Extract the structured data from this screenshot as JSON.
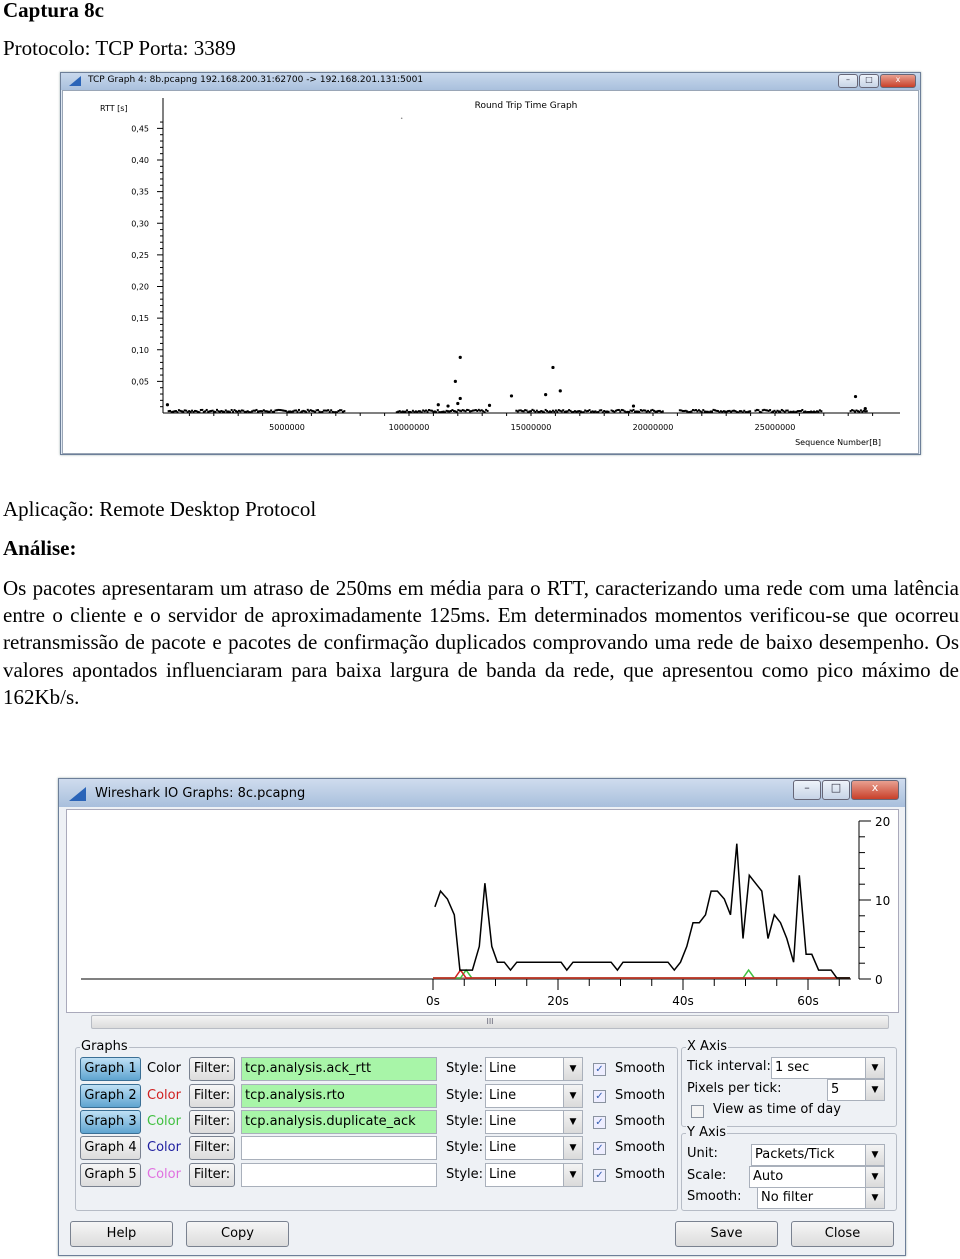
{
  "doc": {
    "heading": "Captura 8c",
    "protocol_line": "Protocolo: TCP  Porta: 3389",
    "application_line": "Aplicação: Remote Desktop Protocol",
    "analysis_label": "Análise:",
    "analysis_text": "Os pacotes apresentaram um atraso de 250ms em média para o RTT, caracterizando uma rede com uma latência entre o cliente e o servidor de aproximadamente 125ms. Em determinados momentos verificou-se que ocorreu retransmissão de pacote e pacotes de confirmação duplicados comprovando uma rede de baixo desempenho. Os valores apontados influenciaram para baixa largura de banda da rede, que apresentou como pico máximo de 162Kb/s."
  },
  "rtt_window": {
    "title": "TCP Graph 4: 8b.pcapng 192.168.200.31:62700 -> 192.168.201.131:5001",
    "controls": {
      "minimize": "–",
      "maximize": "□",
      "close": "x"
    }
  },
  "io_window": {
    "title": "Wireshark IO Graphs: 8c.pcapng",
    "controls": {
      "minimize": "–",
      "maximize": "□",
      "close": "x"
    },
    "graphs_legend": "Graphs",
    "color_label": "Color",
    "filter_label": "Filter:",
    "style_label": "Style:",
    "smooth_label": "Smooth",
    "graphs": [
      {
        "name": "Graph 1",
        "color": "#000000",
        "filter": "tcp.analysis.ack_rtt",
        "style": "Line",
        "smooth": true,
        "active": true
      },
      {
        "name": "Graph 2",
        "color": "#d02020",
        "filter": "tcp.analysis.rto",
        "style": "Line",
        "smooth": true,
        "active": true
      },
      {
        "name": "Graph 3",
        "color": "#40c040",
        "filter": "tcp.analysis.duplicate_ack",
        "style": "Line",
        "smooth": true,
        "active": true
      },
      {
        "name": "Graph 4",
        "color": "#2020a0",
        "filter": "",
        "style": "Line",
        "smooth": true,
        "active": false
      },
      {
        "name": "Graph 5",
        "color": "#e070e0",
        "filter": "",
        "style": "Line",
        "smooth": true,
        "active": false
      }
    ],
    "x_axis": {
      "legend": "X Axis",
      "tick_interval_label": "Tick interval:",
      "tick_interval": "1 sec",
      "pixels_per_tick_label": "Pixels per tick:",
      "pixels_per_tick": "5",
      "time_of_day_label": "View as time of day",
      "time_of_day": false
    },
    "y_axis": {
      "legend": "Y Axis",
      "unit_label": "Unit:",
      "unit": "Packets/Tick",
      "scale_label": "Scale:",
      "scale": "Auto",
      "smooth_label": "Smooth:",
      "smooth": "No filter"
    },
    "buttons": {
      "help": "Help",
      "copy": "Copy",
      "save": "Save",
      "close": "Close"
    },
    "scrollbar_grip": "III"
  },
  "chart_data": [
    {
      "type": "scatter",
      "title": "Round Trip Time Graph",
      "ylabel": "RTT [s]",
      "xlabel": "Sequence Number[B]",
      "xlim": [
        0,
        30000000
      ],
      "ylim": [
        0,
        0.47
      ],
      "yticks": [
        "0,05",
        "0,10",
        "0,15",
        "0,20",
        "0,25",
        "0,30",
        "0,35",
        "0,40",
        "0,45"
      ],
      "ytick_values": [
        0.05,
        0.1,
        0.15,
        0.2,
        0.25,
        0.3,
        0.35,
        0.4,
        0.45
      ],
      "xticks": [
        "5000000",
        "10000000",
        "15000000",
        "20000000",
        "25000000"
      ],
      "xtick_values": [
        5000000,
        10000000,
        15000000,
        20000000,
        25000000
      ],
      "dense_low_rtt_ranges": [
        [
          150000,
          7400000
        ],
        [
          9500000,
          13250000
        ],
        [
          14400000,
          18200000
        ],
        [
          18300000,
          20400000
        ],
        [
          21100000,
          24000000
        ],
        [
          24200000,
          26900000
        ],
        [
          28100000,
          28800000
        ]
      ],
      "outliers": [
        [
          9700000,
          0.466
        ],
        [
          12100000,
          0.088
        ],
        [
          11900000,
          0.05
        ],
        [
          12100000,
          0.023
        ],
        [
          11200000,
          0.013
        ],
        [
          11600000,
          0.011
        ],
        [
          12000000,
          0.015
        ],
        [
          13300000,
          0.012
        ],
        [
          14200000,
          0.027
        ],
        [
          15600000,
          0.029
        ],
        [
          15900000,
          0.072
        ],
        [
          16200000,
          0.035
        ],
        [
          19200000,
          0.011
        ],
        [
          28300000,
          0.026
        ],
        [
          28700000,
          0.007
        ],
        [
          100000,
          0.013
        ]
      ],
      "color": "#000000"
    },
    {
      "type": "line",
      "x_unit": "s",
      "xlim": [
        0,
        67
      ],
      "ylim": [
        0,
        20
      ],
      "xticks": [
        "0s",
        "20s",
        "40s",
        "60s"
      ],
      "xtick_values": [
        0,
        20,
        40,
        60
      ],
      "yticks": [
        "0",
        "10",
        "20"
      ],
      "ytick_values": [
        0,
        10,
        20
      ],
      "series": [
        {
          "color": "#000000",
          "x": [
            0.3,
            1.2,
            2.3,
            3.4,
            4.3,
            6.3,
            7.4,
            8.3,
            9.4,
            10.3,
            11.4,
            12.4,
            13.4,
            20.5,
            21.4,
            22.4,
            28.5,
            29.5,
            30.4,
            37.6,
            38.6,
            39.6,
            40.6,
            41.6,
            42.6,
            43.6,
            44.5,
            45.5,
            46.6,
            47.6,
            48.6,
            49.6,
            50.6,
            51.6,
            52.6,
            53.6,
            54.6,
            55.6,
            56.6,
            57.7,
            58.6,
            59.7,
            60.6,
            61.7,
            63.7,
            64.6,
            66.7
          ],
          "y": [
            9,
            11,
            10,
            8,
            1,
            1,
            4,
            12,
            4,
            2,
            2,
            1,
            2,
            2,
            1,
            2,
            2,
            1,
            2,
            2,
            1,
            2,
            4,
            7,
            7,
            8,
            11,
            11,
            10,
            8,
            17,
            5,
            13,
            12,
            11,
            5,
            8,
            7,
            5,
            2,
            13,
            3,
            3,
            1,
            1,
            0,
            0
          ]
        },
        {
          "color": "#d02020",
          "x": [
            0,
            3.5,
            4.4,
            5.3,
            66.7
          ],
          "y": [
            0,
            0,
            1,
            0,
            0
          ]
        },
        {
          "color": "#40c040",
          "x": [
            0,
            4.4,
            5.3,
            6.2,
            49.6,
            50.5,
            51.4,
            66.7
          ],
          "y": [
            0,
            0,
            1,
            0,
            0,
            1,
            0,
            0
          ]
        }
      ]
    }
  ]
}
